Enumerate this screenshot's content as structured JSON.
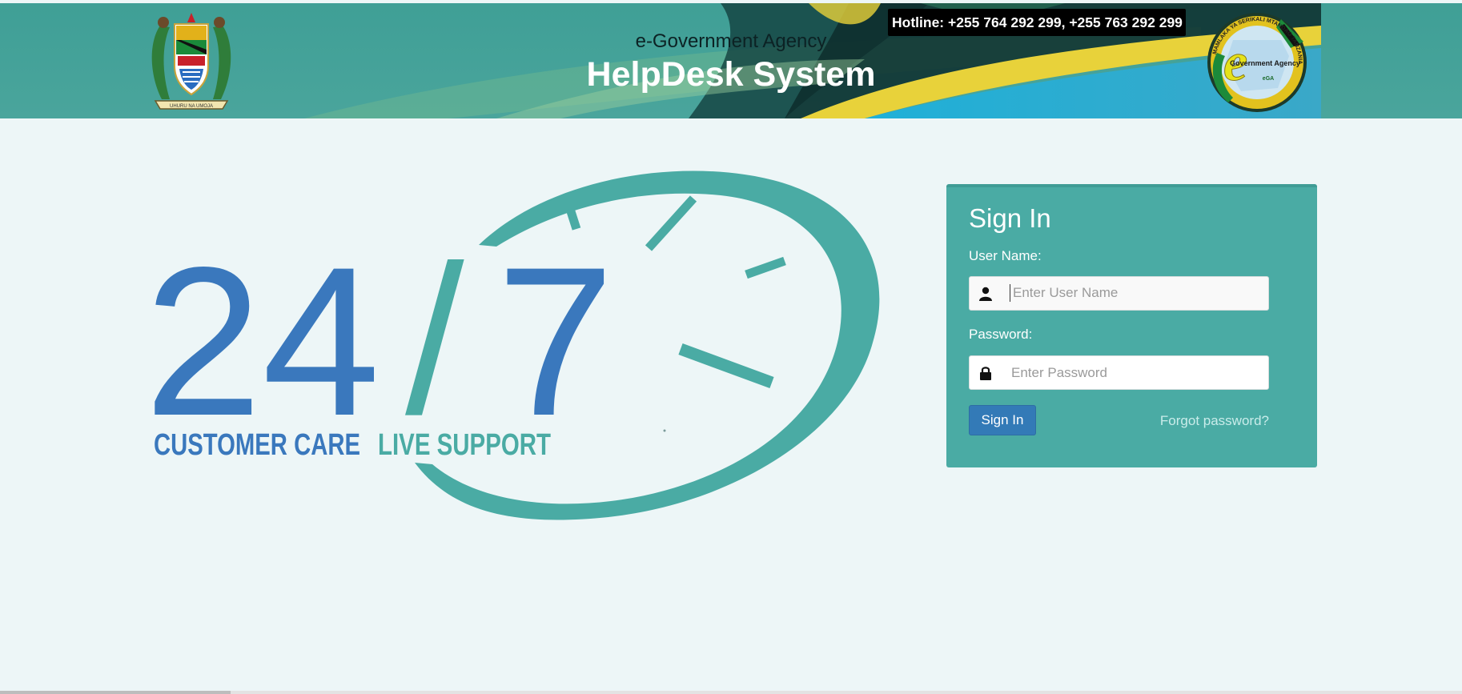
{
  "header": {
    "agency_name": "e-Government Agency",
    "system_title": "HelpDesk System",
    "hotline": "Hotline: +255 764 292 299, +255 763 292 299",
    "ega_logo": {
      "ring_text": "MAMLAKA YA SERIKALI MTANDAO TANZANIA",
      "center_text": "Government Agency",
      "abbr": "eGA"
    },
    "coat_of_arms_motto": "UHURU NA UMOJA"
  },
  "hero": {
    "number_left": "24",
    "number_right": "7",
    "slash": "/",
    "tagline_left": "CUSTOMER CARE",
    "tagline_right": "LIVE SUPPORT"
  },
  "signin": {
    "title": "Sign In",
    "username_label": "User Name:",
    "username_placeholder": "Enter User Name",
    "password_label": "Password:",
    "password_placeholder": "Enter Password",
    "button_label": "Sign In",
    "forgot_label": "Forgot password?"
  },
  "icons": {
    "user": "user-icon",
    "lock": "lock-icon"
  },
  "colors": {
    "teal": "#4aaba4",
    "blue": "#3a78bd",
    "button_blue": "#337ab7",
    "page_bg": "#edf6f7"
  }
}
